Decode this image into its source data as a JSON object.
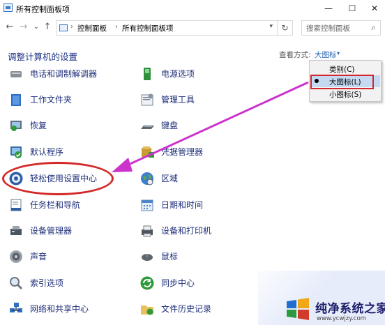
{
  "window": {
    "title": "所有控制面板项",
    "minimize": "—",
    "maximize": "☐",
    "close": "✕"
  },
  "nav": {
    "back": "←",
    "forward": "→",
    "history": "⌄",
    "up": "↑"
  },
  "address": {
    "crumbs": [
      "控制面板",
      "所有控制面板项"
    ],
    "separator": "›",
    "dropdown": "▾",
    "refresh": "↻"
  },
  "search": {
    "placeholder": "搜索控制面板",
    "icon": "⌕"
  },
  "header": {
    "title": "调整计算机的设置",
    "view_by_label": "查看方式:",
    "view_by_value": "大图标",
    "caret": "▾"
  },
  "view_menu": {
    "options": [
      "类别(C)",
      "大图标(L)",
      "小图标(S)"
    ],
    "selected": "大图标(L)"
  },
  "items": {
    "left": [
      {
        "label": "电话和调制解调器",
        "icon": "phone-modem-icon"
      },
      {
        "label": "工作文件夹",
        "icon": "work-folders-icon"
      },
      {
        "label": "恢复",
        "icon": "recovery-icon"
      },
      {
        "label": "默认程序",
        "icon": "default-programs-icon"
      },
      {
        "label": "轻松使用设置中心",
        "icon": "ease-of-access-icon"
      },
      {
        "label": "任务栏和导航",
        "icon": "taskbar-icon"
      },
      {
        "label": "设备管理器",
        "icon": "device-manager-icon"
      },
      {
        "label": "声音",
        "icon": "sound-icon"
      },
      {
        "label": "索引选项",
        "icon": "indexing-icon"
      },
      {
        "label": "网络和共享中心",
        "icon": "network-icon"
      }
    ],
    "right": [
      {
        "label": "电源选项",
        "icon": "power-icon"
      },
      {
        "label": "管理工具",
        "icon": "admin-tools-icon"
      },
      {
        "label": "键盘",
        "icon": "keyboard-icon"
      },
      {
        "label": "凭据管理器",
        "icon": "credential-icon"
      },
      {
        "label": "区域",
        "icon": "region-icon"
      },
      {
        "label": "日期和时间",
        "icon": "datetime-icon"
      },
      {
        "label": "设备和打印机",
        "icon": "printer-icon"
      },
      {
        "label": "鼠标",
        "icon": "mouse-icon"
      },
      {
        "label": "同步中心",
        "icon": "sync-icon"
      },
      {
        "label": "文件历史记录",
        "icon": "file-history-icon"
      }
    ]
  },
  "watermark": {
    "title": "纯净系统之家",
    "url": "www.ycwjzy.com"
  },
  "colors": {
    "link": "#1e2e7a",
    "header": "#1e3287",
    "annotation_red": "#d42828",
    "arrow_magenta": "#cc33cc",
    "menu_highlight": "#c5daf2"
  }
}
